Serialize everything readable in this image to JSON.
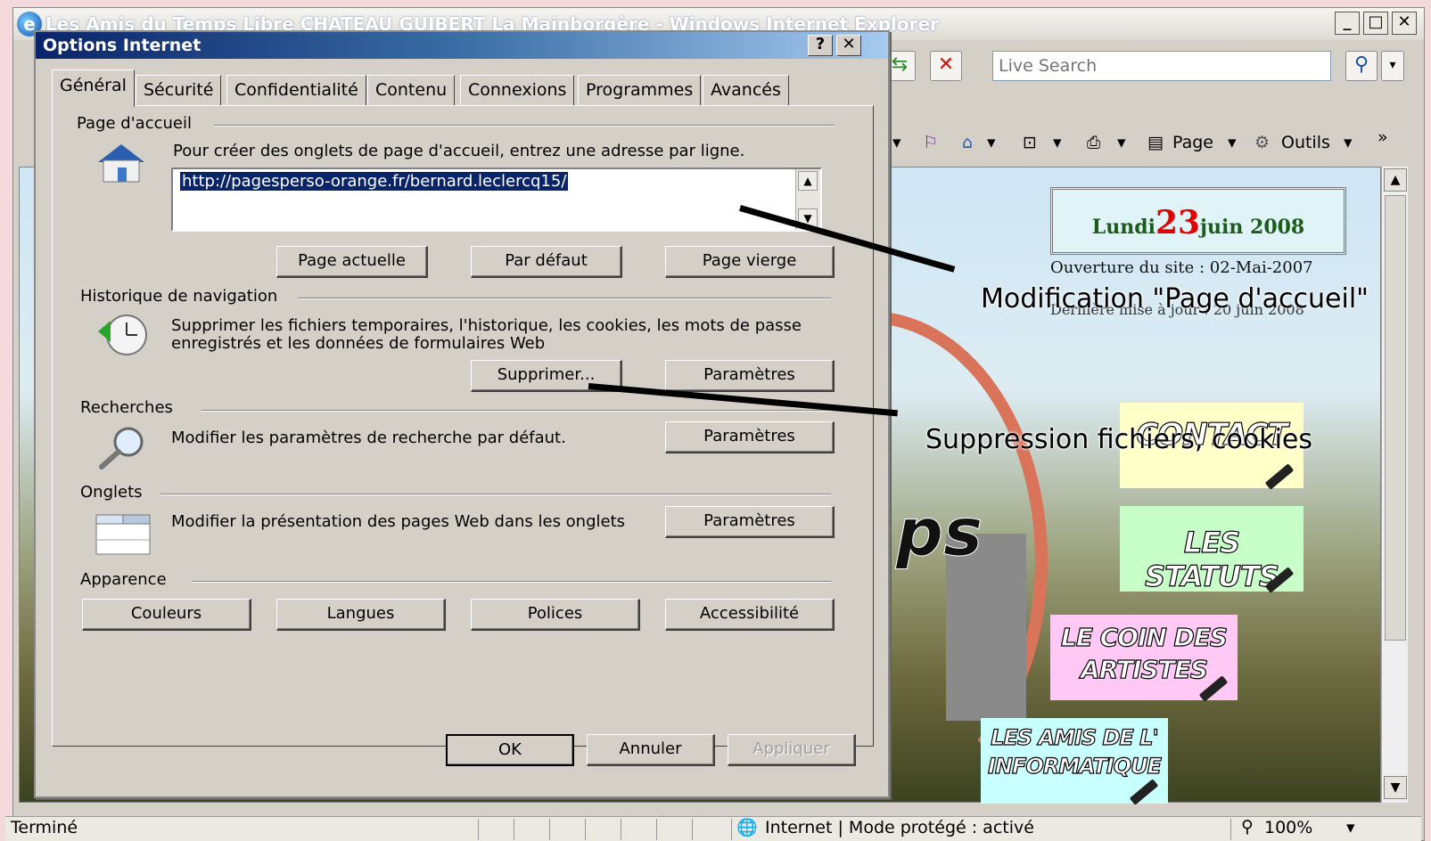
{
  "browser": {
    "title": "Les Amis du Temps Libre CHATEAU GUIBERT La Mainborgère - Windows Internet Explorer",
    "search_placeholder": "Live Search",
    "toolbar": {
      "page_label": "Page",
      "tools_label": "Outils"
    },
    "status": {
      "left": "Terminé",
      "zone": "Internet | Mode protégé : activé",
      "zoom": "100%"
    }
  },
  "webpage": {
    "date_prefix": "Lundi",
    "date_day": "23",
    "date_suffix": "juin 2008",
    "opening": "Ouverture du site : 02-Mai-2007",
    "update": "Dernière mise à jour : 20 juin 2008",
    "overlay_fragment": "ps",
    "cards": {
      "contact": "CONTACT",
      "statuts": "LES STATUTS",
      "artistes_1": "LE COIN DES",
      "artistes_2": "ARTISTES",
      "info_1": "LES AMIS DE L'",
      "info_2": "INFORMATIQUE"
    }
  },
  "annotations": {
    "homepage": "Modification \"Page d'accueil\"",
    "delete": "Suppression fichiers, cookies"
  },
  "dialog": {
    "title": "Options Internet",
    "help_label": "?",
    "close_label": "✕",
    "tabs": [
      "Général",
      "Sécurité",
      "Confidentialité",
      "Contenu",
      "Connexions",
      "Programmes",
      "Avancés"
    ],
    "homepage": {
      "title": "Page d'accueil",
      "description": "Pour créer des onglets de page d'accueil, entrez une adresse par ligne.",
      "url": "http://pagesperso-orange.fr/bernard.leclercq15/",
      "btn_current": "Page actuelle",
      "btn_default": "Par défaut",
      "btn_blank": "Page vierge"
    },
    "history": {
      "title": "Historique de navigation",
      "line1": "Supprimer les fichiers temporaires, l'historique, les cookies, les mots de passe",
      "line2": "enregistrés et les données de formulaires Web",
      "btn_delete": "Supprimer...",
      "btn_settings": "Paramètres"
    },
    "search": {
      "title": "Recherches",
      "description": "Modifier les paramètres de recherche par défaut.",
      "btn_settings": "Paramètres"
    },
    "tabs_section": {
      "title": "Onglets",
      "description": "Modifier la présentation des pages Web dans les onglets",
      "btn_settings": "Paramètres"
    },
    "appearance": {
      "title": "Apparence",
      "btn_colors": "Couleurs",
      "btn_languages": "Langues",
      "btn_fonts": "Polices",
      "btn_accessibility": "Accessibilité"
    },
    "footer": {
      "ok": "OK",
      "cancel": "Annuler",
      "apply": "Appliquer"
    }
  }
}
